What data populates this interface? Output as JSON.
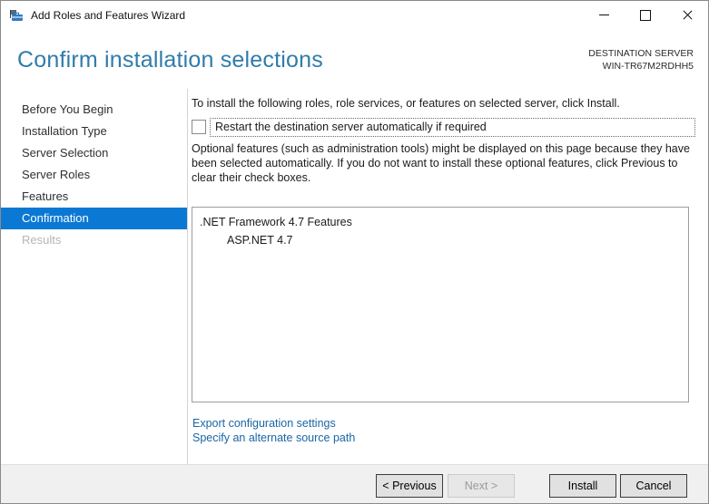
{
  "window": {
    "title": "Add Roles and Features Wizard",
    "app_icon": "roles-wizard-toolbox-icon",
    "controls": [
      "minimize-icon",
      "maximize-icon",
      "close-icon"
    ]
  },
  "header": {
    "title": "Confirm installation selections",
    "destination_label": "DESTINATION SERVER",
    "destination_server": "WIN-TR67M2RDHH5"
  },
  "sidebar": {
    "items": [
      {
        "label": "Before You Begin",
        "state": "normal"
      },
      {
        "label": "Installation Type",
        "state": "normal"
      },
      {
        "label": "Server Selection",
        "state": "normal"
      },
      {
        "label": "Server Roles",
        "state": "normal"
      },
      {
        "label": "Features",
        "state": "normal"
      },
      {
        "label": "Confirmation",
        "state": "selected"
      },
      {
        "label": "Results",
        "state": "disabled"
      }
    ]
  },
  "main": {
    "intro": "To install the following roles, role services, or features on selected server, click Install.",
    "restart_checkbox": {
      "label": "Restart the destination server automatically if required",
      "checked": false
    },
    "optional_note": "Optional features (such as administration tools) might be displayed on this page because they have been selected automatically. If you do not want to install these optional features, click Previous to clear their check boxes.",
    "selection_tree": [
      {
        "label": ".NET Framework 4.7 Features",
        "level": 0
      },
      {
        "label": "ASP.NET 4.7",
        "level": 1
      }
    ],
    "links": [
      "Export configuration settings",
      "Specify an alternate source path"
    ]
  },
  "footer": {
    "buttons": [
      {
        "label": "< Previous",
        "enabled": true
      },
      {
        "label": "Next >",
        "enabled": false
      },
      {
        "label": "Install",
        "enabled": true
      },
      {
        "label": "Cancel",
        "enabled": true
      }
    ]
  },
  "colors": {
    "accent_blue": "#0b79d4",
    "header_title": "#2f7cab",
    "link": "#1a66a5",
    "disabled_text": "#b5b5b5",
    "footer_bg": "#f0f0f0",
    "button_bg": "#e1e1e1"
  }
}
